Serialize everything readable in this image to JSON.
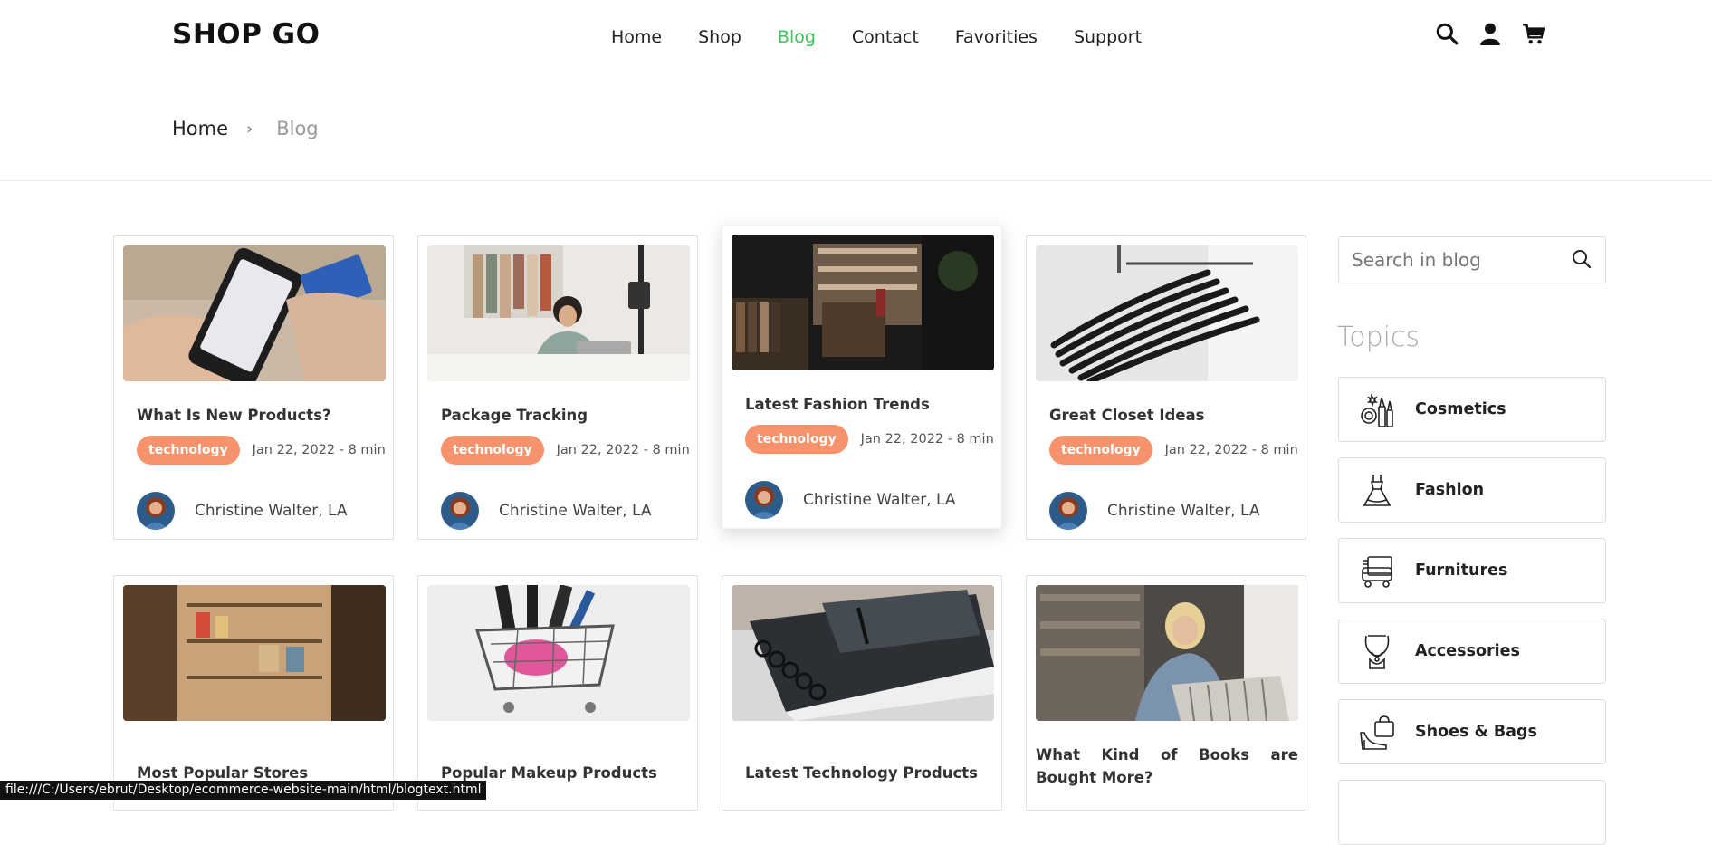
{
  "header": {
    "logo": "SHOP GO",
    "nav": [
      {
        "label": "Home",
        "active": false
      },
      {
        "label": "Shop",
        "active": false
      },
      {
        "label": "Blog",
        "active": true
      },
      {
        "label": "Contact",
        "active": false
      },
      {
        "label": "Favorities",
        "active": false
      },
      {
        "label": "Support",
        "active": false
      }
    ],
    "icons": [
      "search-icon",
      "user-icon",
      "cart-icon"
    ]
  },
  "breadcrumb": {
    "home": "Home",
    "separator": "›",
    "current": "Blog"
  },
  "posts": [
    {
      "title": "What Is New Products?",
      "tag": "technology",
      "date": "Jan 22, 2022 - 8 min",
      "author": "Christine Walter, LA"
    },
    {
      "title": "Package Tracking",
      "tag": "technology",
      "date": "Jan 22, 2022 - 8 min",
      "author": "Christine Walter, LA"
    },
    {
      "title": "Latest Fashion Trends",
      "tag": "technology",
      "date": "Jan 22, 2022 - 8 min",
      "author": "Christine Walter, LA"
    },
    {
      "title": "Great Closet Ideas",
      "tag": "technology",
      "date": "Jan 22, 2022 - 8 min",
      "author": "Christine Walter, LA"
    },
    {
      "title": "Most Popular Stores",
      "tag": "",
      "date": "",
      "author": ""
    },
    {
      "title": "Popular Makeup Products",
      "tag": "",
      "date": "",
      "author": ""
    },
    {
      "title": "Latest Technology Products",
      "tag": "",
      "date": "",
      "author": ""
    },
    {
      "title": "What Kind of Books are Bought More?",
      "tag": "",
      "date": "",
      "author": ""
    }
  ],
  "sidebar": {
    "search_placeholder": "Search in blog",
    "topics_title": "Topics",
    "topics": [
      {
        "label": "Cosmetics",
        "icon": "cosmetics-icon"
      },
      {
        "label": "Fashion",
        "icon": "dress-icon"
      },
      {
        "label": "Furnitures",
        "icon": "furniture-icon"
      },
      {
        "label": "Accessories",
        "icon": "necklace-icon"
      },
      {
        "label": "Shoes & Bags",
        "icon": "bag-shoe-icon"
      }
    ]
  },
  "status_bar": "file:///C:/Users/ebrut/Desktop/ecommerce-website-main/html/blogtext.html",
  "colors": {
    "accent": "#3bc45a",
    "tag": "#f7936c",
    "text": "#222222"
  }
}
